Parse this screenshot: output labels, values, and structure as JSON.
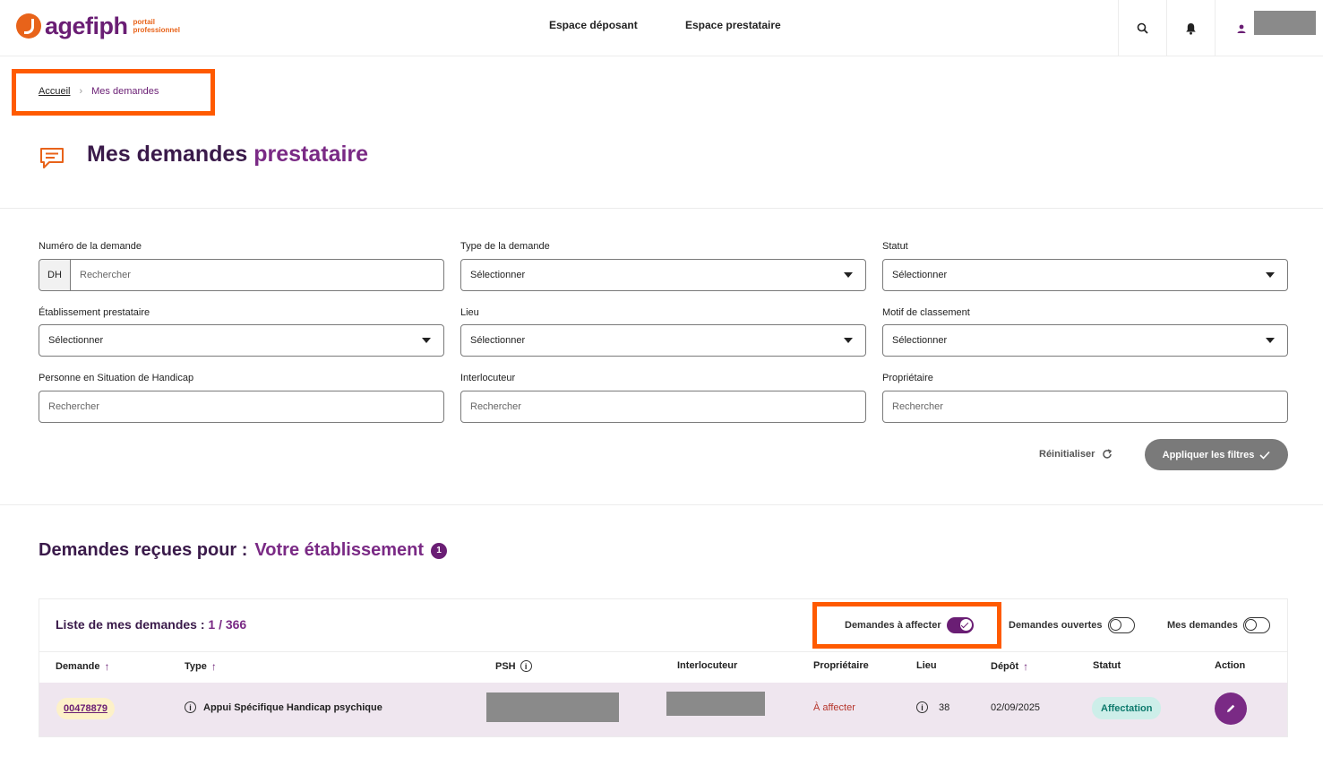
{
  "header": {
    "logo_text": "agefiph",
    "logo_sub1": "portail",
    "logo_sub2": "professionnel",
    "nav": [
      "Espace déposant",
      "Espace prestataire"
    ]
  },
  "breadcrumb": {
    "home": "Accueil",
    "current": "Mes demandes"
  },
  "page": {
    "title_main": "Mes demandes",
    "title_accent": "prestataire"
  },
  "filters": {
    "numero": {
      "label": "Numéro de la demande",
      "prefix": "DH",
      "placeholder": "Rechercher"
    },
    "type": {
      "label": "Type de la demande",
      "value": "Sélectionner"
    },
    "statut": {
      "label": "Statut",
      "value": "Sélectionner"
    },
    "etablissement": {
      "label": "Établissement prestataire",
      "value": "Sélectionner"
    },
    "lieu": {
      "label": "Lieu",
      "value": "Sélectionner"
    },
    "motif": {
      "label": "Motif de classement",
      "value": "Sélectionner"
    },
    "psh": {
      "label": "Personne en Situation de Handicap",
      "placeholder": "Rechercher"
    },
    "interlocuteur": {
      "label": "Interlocuteur",
      "placeholder": "Rechercher"
    },
    "proprietaire": {
      "label": "Propriétaire",
      "placeholder": "Rechercher"
    },
    "reset_label": "Réinitialiser",
    "apply_label": "Appliquer les filtres"
  },
  "section": {
    "title": "Demandes reçues pour :",
    "accent": "Votre établissement",
    "badge": "1"
  },
  "list": {
    "title": "Liste de mes demandes :",
    "count": "1 / 366",
    "toggles": [
      {
        "label": "Demandes à affecter",
        "on": true
      },
      {
        "label": "Demandes ouvertes",
        "on": false
      },
      {
        "label": "Mes demandes",
        "on": false
      }
    ],
    "columns": [
      "Demande",
      "Type",
      "PSH",
      "Interlocuteur",
      "Propriétaire",
      "Lieu",
      "Dépôt",
      "Statut",
      "Action"
    ],
    "rows": [
      {
        "demande": "00478879",
        "type": "Appui Spécifique Handicap psychique",
        "proprietaire": "À affecter",
        "lieu": "38",
        "depot": "02/09/2025",
        "statut": "Affectation"
      }
    ]
  },
  "colors": {
    "brand": "#6a1e74",
    "accent": "#e8631a",
    "highlight": "#ff5a00",
    "status": "#0e7a6d"
  }
}
